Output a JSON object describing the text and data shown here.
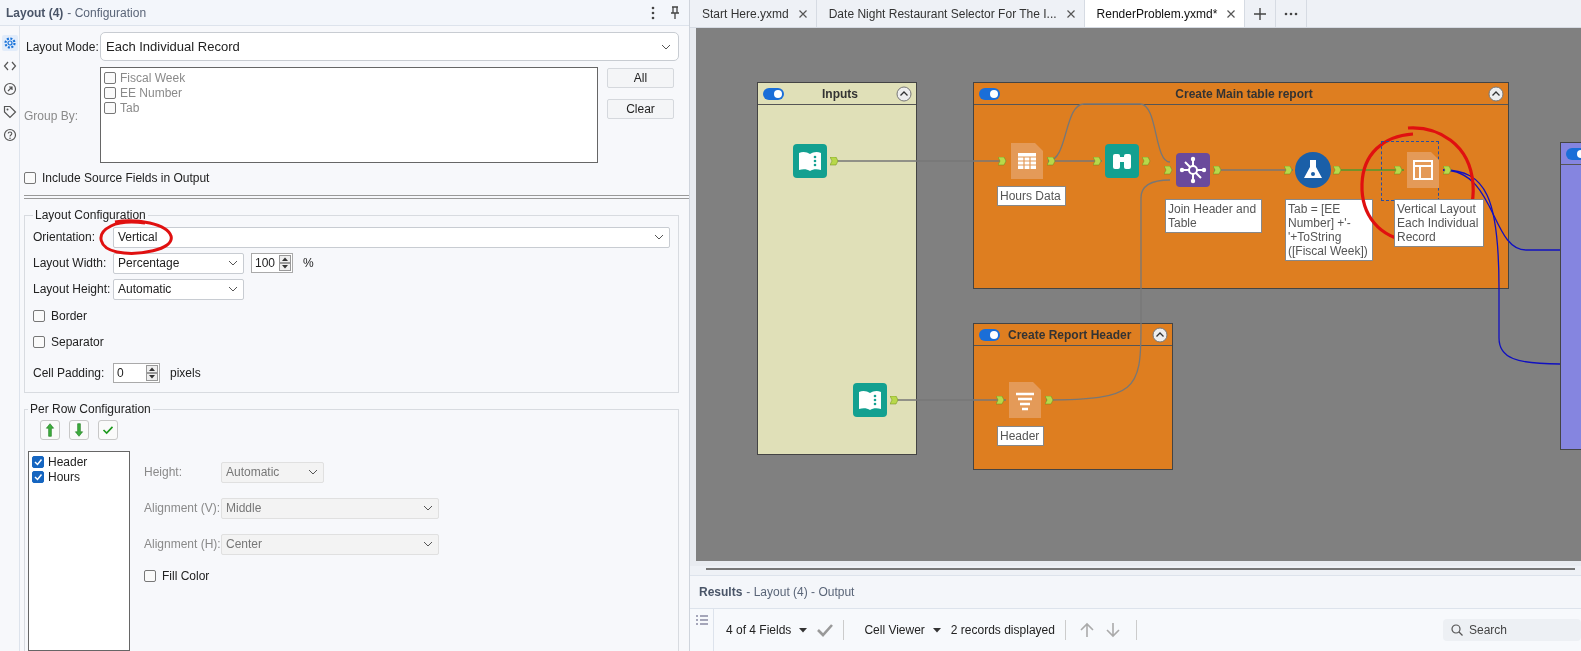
{
  "config_panel": {
    "title": "Layout (4)",
    "subtitle": "- Configuration",
    "side_icons": [
      {
        "kind": "gear",
        "selected": true
      },
      {
        "kind": "code",
        "selected": false
      },
      {
        "kind": "arrow",
        "selected": false
      },
      {
        "kind": "tag",
        "selected": false
      },
      {
        "kind": "help",
        "selected": false
      }
    ],
    "layout_mode": {
      "label": "Layout Mode:",
      "value": "Each Individual Record"
    },
    "group_by": {
      "label": "Group By:",
      "fields": [
        {
          "name": "Fiscal Week",
          "checked": false
        },
        {
          "name": "EE Number",
          "checked": false
        },
        {
          "name": "Tab",
          "checked": false
        }
      ],
      "buttons": [
        "All",
        "Clear"
      ]
    },
    "include_source": {
      "label": "Include Source Fields in Output",
      "checked": false
    },
    "layout_configuration": {
      "title": "Layout Configuration",
      "orientation": {
        "label": "Orientation:",
        "value": "Vertical"
      },
      "layout_width": {
        "label": "Layout Width:",
        "value": "Percentage",
        "amount": "100",
        "unit": "%"
      },
      "layout_height": {
        "label": "Layout Height:",
        "value": "Automatic"
      },
      "border": {
        "label": "Border",
        "checked": false
      },
      "separator": {
        "label": "Separator",
        "checked": false
      },
      "cell_padding": {
        "label": "Cell Padding:",
        "value": "0",
        "unit": "pixels"
      }
    },
    "per_row_configuration": {
      "title": "Per Row Configuration",
      "rows": [
        {
          "name": "Header",
          "checked": true
        },
        {
          "name": "Hours",
          "checked": true
        }
      ],
      "height": {
        "label": "Height:",
        "value": "Automatic",
        "disabled": true
      },
      "alignment_v": {
        "label": "Alignment (V):",
        "value": "Middle",
        "disabled": true
      },
      "alignment_h": {
        "label": "Alignment (H):",
        "value": "Center",
        "disabled": true
      },
      "fill_color": {
        "label": "Fill Color",
        "checked": false
      }
    }
  },
  "tabs": [
    {
      "label": "Start Here.yxmd",
      "selected": false
    },
    {
      "label": "Date Night Restaurant Selector For The I...",
      "selected": false
    },
    {
      "label": "RenderProblem.yxmd*",
      "selected": true
    }
  ],
  "canvas": {
    "containers": [
      {
        "title": "Inputs",
        "enabled": true,
        "color": "#e0e0b8"
      },
      {
        "title": "Create Main table report",
        "enabled": true,
        "color": "#de7e20"
      },
      {
        "title": "Create Report Header",
        "enabled": true,
        "color": "#de7e20"
      },
      {
        "enabled": true,
        "color": "#8585e0"
      }
    ],
    "tools": [
      {
        "kind": "input"
      },
      {
        "kind": "table",
        "label": "Hours Data"
      },
      {
        "kind": "browse"
      },
      {
        "kind": "join",
        "label": "Join Header and Table"
      },
      {
        "kind": "formula",
        "label": "Tab = [EE Number] +'-'+ToString ([Fiscal Week])"
      },
      {
        "kind": "layout",
        "label": "Vertical Layout Each Individual Record",
        "selected": true
      },
      {
        "kind": "input"
      },
      {
        "kind": "report_text",
        "label": "Header"
      }
    ]
  },
  "results": {
    "title": "Results",
    "subtitle": "- Layout (4) - Output",
    "fields": "4 of 4 Fields",
    "viewer": "Cell Viewer",
    "records": "2 records displayed",
    "search_placeholder": "Search"
  }
}
